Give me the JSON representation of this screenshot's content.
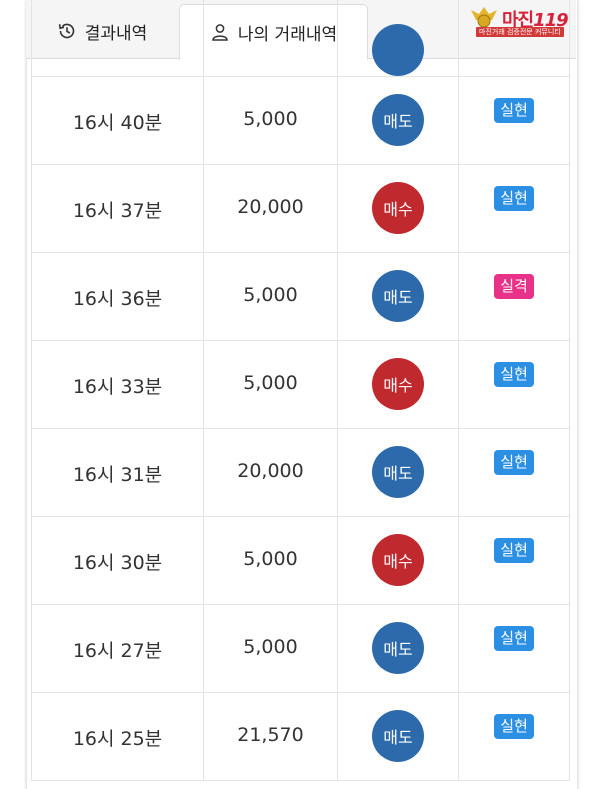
{
  "tabs": [
    {
      "label": "결과내역",
      "icon": "history-icon"
    },
    {
      "label": "나의 거래내역",
      "icon": "user-icon"
    }
  ],
  "logo": {
    "brand": "마진",
    "brand_suffix": "119",
    "tagline": "마진거래 검증전문 커뮤니티"
  },
  "colors": {
    "sell": "#2c6aac",
    "buy": "#c02a2f",
    "success": "#2b8fe3",
    "fail": "#e83189"
  },
  "trades": [
    {
      "time": "",
      "amount": "",
      "side": "",
      "side_type": "sell",
      "result": "",
      "result_type": "ok"
    },
    {
      "time": "16시 40분",
      "amount": "5,000",
      "side": "매도",
      "side_type": "sell",
      "result": "실현",
      "result_type": "ok"
    },
    {
      "time": "16시 37분",
      "amount": "20,000",
      "side": "매수",
      "side_type": "buy",
      "result": "실현",
      "result_type": "ok"
    },
    {
      "time": "16시 36분",
      "amount": "5,000",
      "side": "매도",
      "side_type": "sell",
      "result": "실격",
      "result_type": "fail"
    },
    {
      "time": "16시 33분",
      "amount": "5,000",
      "side": "매수",
      "side_type": "buy",
      "result": "실현",
      "result_type": "ok"
    },
    {
      "time": "16시 31분",
      "amount": "20,000",
      "side": "매도",
      "side_type": "sell",
      "result": "실현",
      "result_type": "ok"
    },
    {
      "time": "16시 30분",
      "amount": "5,000",
      "side": "매수",
      "side_type": "buy",
      "result": "실현",
      "result_type": "ok"
    },
    {
      "time": "16시 27분",
      "amount": "5,000",
      "side": "매도",
      "side_type": "sell",
      "result": "실현",
      "result_type": "ok"
    },
    {
      "time": "16시 25분",
      "amount": "21,570",
      "side": "매도",
      "side_type": "sell",
      "result": "실현",
      "result_type": "ok"
    }
  ]
}
